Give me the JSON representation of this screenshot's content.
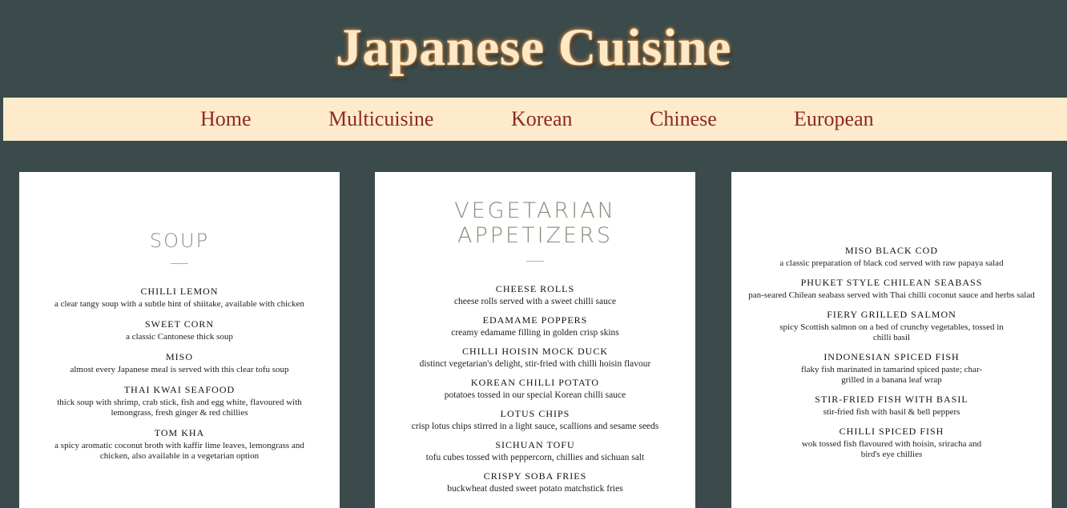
{
  "site": {
    "title": "Japanese Cuisine"
  },
  "nav": {
    "items": [
      {
        "label": "Home"
      },
      {
        "label": "Multicuisine"
      },
      {
        "label": "Korean"
      },
      {
        "label": "Chinese"
      },
      {
        "label": "European"
      }
    ]
  },
  "soup_card": {
    "heading": "SOUP",
    "items": [
      {
        "name": "CHILLI LEMON",
        "desc": "a clear tangy soup with a subtle hint of shiitake, available with chicken"
      },
      {
        "name": "SWEET CORN",
        "desc": "a classic Cantonese thick soup"
      },
      {
        "name": "MISO",
        "desc": "almost every Japanese meal is served with this clear tofu soup"
      },
      {
        "name": "THAI KWAI SEAFOOD",
        "desc": "thick soup with shrimp, crab stick, fish and egg white, flavoured with lemongrass, fresh ginger & red chillies"
      },
      {
        "name": "TOM KHA",
        "desc": "a spicy aromatic coconut broth with kaffir lime leaves, lemongrass and chicken, also available in a vegetarian option"
      }
    ]
  },
  "veg_card": {
    "heading": "VEGETARIAN APPETIZERS",
    "items": [
      {
        "name": "CHEESE ROLLS",
        "desc": "cheese rolls served with a sweet chilli sauce"
      },
      {
        "name": "EDAMAME POPPERS",
        "desc": "creamy edamame filling in golden crisp skins"
      },
      {
        "name": "CHILLI HOISIN MOCK DUCK",
        "desc": "distinct vegetarian's delight, stir-fried with chilli hoisin flavour"
      },
      {
        "name": "KOREAN CHILLI POTATO",
        "desc": "potatoes tossed in our special Korean chilli sauce"
      },
      {
        "name": "LOTUS CHIPS",
        "desc": "crisp lotus chips stirred in a light sauce, scallions and sesame seeds"
      },
      {
        "name": "SICHUAN TOFU",
        "desc": "tofu cubes tossed with peppercorn, chillies and sichuan salt"
      },
      {
        "name": "CRISPY SOBA FRIES",
        "desc": "buckwheat dusted sweet potato matchstick fries"
      }
    ]
  },
  "fish_card": {
    "items": [
      {
        "name": "MISO BLACK COD",
        "desc": "a classic preparation of black cod served with raw papaya salad"
      },
      {
        "name": "PHUKET STYLE CHILEAN SEABASS",
        "desc": "pan-seared Chilean seabass served with Thai chilli coconut sauce and herbs salad"
      },
      {
        "name": "FIERY GRILLED SALMON",
        "desc": "spicy Scottish salmon on a bed of crunchy vegetables, tossed in chilli basil"
      },
      {
        "name": "INDONESIAN SPICED FISH",
        "desc": "flaky fish marinated in tamarind spiced paste; char-grilled in a banana leaf wrap"
      },
      {
        "name": "STIR-FRIED FISH WITH BASIL",
        "desc": "stir-fried fish with basil & bell peppers"
      },
      {
        "name": "CHILLI SPICED FISH",
        "desc": "wok tossed fish flavoured with hoisin, sriracha and bird's eye chillies"
      }
    ]
  }
}
